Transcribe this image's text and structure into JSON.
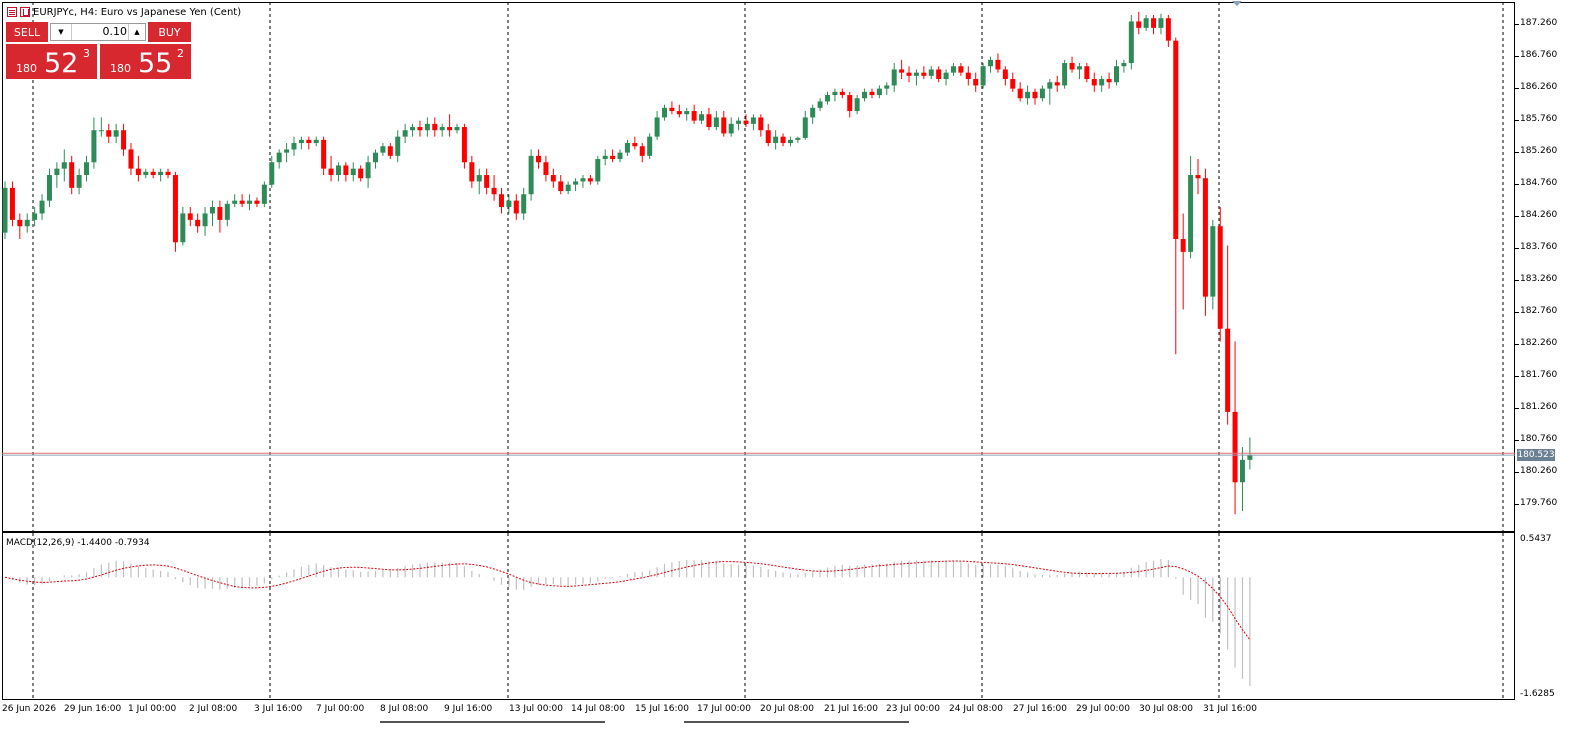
{
  "window": {
    "title": "EURJPYc, H4:  Euro vs Japanese Yen (Cent)",
    "icons": [
      "chart-list-icon",
      "one-click-trading-icon"
    ]
  },
  "trade_panel": {
    "sell_label": "SELL",
    "buy_label": "BUY",
    "lot_value": "0.10",
    "lot_down_icon": "triangle-down-icon",
    "lot_up_icon": "triangle-up-icon",
    "sell_price": {
      "int": "180",
      "big": "52",
      "sup": "3"
    },
    "buy_price": {
      "int": "180",
      "big": "55",
      "sup": "2"
    },
    "color": "#d8282f"
  },
  "price_axis": {
    "labels": [
      "187.260",
      "186.760",
      "186.260",
      "185.760",
      "185.260",
      "184.760",
      "184.260",
      "183.760",
      "183.260",
      "182.760",
      "182.260",
      "181.760",
      "181.260",
      "180.760",
      "180.260",
      "179.760"
    ],
    "current_price": "180.523",
    "current_price_color": "#6c8094"
  },
  "macd": {
    "label": "MACD(12,26,9) -1.4400 -0.7934",
    "axis_max": "0.5437",
    "axis_min": "-1.6285",
    "signal_color": "#e0000a",
    "histogram_color": "#c0c0c0"
  },
  "time_axis": {
    "labels": [
      "26 Jun 2026",
      "29 Jun 16:00",
      "1 Jul 00:00",
      "2 Jul 08:00",
      "3 Jul 16:00",
      "7 Jul 00:00",
      "8 Jul 08:00",
      "9 Jul 16:00",
      "13 Jul 00:00",
      "14 Jul 08:00",
      "15 Jul 16:00",
      "17 Jul 00:00",
      "20 Jul 08:00",
      "21 Jul 16:00",
      "23 Jul 00:00",
      "24 Jul 08:00",
      "27 Jul 16:00",
      "29 Jul 00:00",
      "30 Jul 08:00",
      "31 Jul 16:00"
    ]
  },
  "chart_data": {
    "type": "candlestick",
    "symbol": "EURJPYc",
    "timeframe": "H4",
    "bull_color": "#2e8b57",
    "bear_color": "#ff0000",
    "ylim": [
      179.55,
      187.55
    ],
    "candles": [
      {
        "o": 184.0,
        "h": 184.8,
        "l": 183.9,
        "c": 184.7
      },
      {
        "o": 184.7,
        "h": 184.8,
        "l": 184.1,
        "c": 184.2
      },
      {
        "o": 184.2,
        "h": 184.3,
        "l": 183.9,
        "c": 184.1
      },
      {
        "o": 184.1,
        "h": 184.3,
        "l": 184.0,
        "c": 184.2
      },
      {
        "o": 184.2,
        "h": 184.4,
        "l": 184.1,
        "c": 184.3
      },
      {
        "o": 184.3,
        "h": 184.6,
        "l": 184.2,
        "c": 184.5
      },
      {
        "o": 184.5,
        "h": 185.0,
        "l": 184.4,
        "c": 184.9
      },
      {
        "o": 184.9,
        "h": 185.1,
        "l": 184.7,
        "c": 185.0
      },
      {
        "o": 185.0,
        "h": 185.3,
        "l": 184.8,
        "c": 185.1
      },
      {
        "o": 185.1,
        "h": 185.2,
        "l": 184.6,
        "c": 184.7
      },
      {
        "o": 184.7,
        "h": 185.0,
        "l": 184.6,
        "c": 184.9
      },
      {
        "o": 184.9,
        "h": 185.2,
        "l": 184.8,
        "c": 185.1
      },
      {
        "o": 185.1,
        "h": 185.8,
        "l": 185.0,
        "c": 185.6
      },
      {
        "o": 185.6,
        "h": 185.8,
        "l": 185.5,
        "c": 185.6
      },
      {
        "o": 185.6,
        "h": 185.7,
        "l": 185.4,
        "c": 185.5
      },
      {
        "o": 185.5,
        "h": 185.7,
        "l": 185.4,
        "c": 185.6
      },
      {
        "o": 185.6,
        "h": 185.7,
        "l": 185.2,
        "c": 185.3
      },
      {
        "o": 185.3,
        "h": 185.4,
        "l": 184.9,
        "c": 185.0
      },
      {
        "o": 185.0,
        "h": 185.2,
        "l": 184.8,
        "c": 184.9
      },
      {
        "o": 184.9,
        "h": 185.0,
        "l": 184.85,
        "c": 184.95
      },
      {
        "o": 184.95,
        "h": 185.0,
        "l": 184.85,
        "c": 184.9
      },
      {
        "o": 184.9,
        "h": 185.0,
        "l": 184.8,
        "c": 184.95
      },
      {
        "o": 184.95,
        "h": 185.0,
        "l": 184.85,
        "c": 184.9
      },
      {
        "o": 184.9,
        "h": 184.95,
        "l": 183.7,
        "c": 183.85
      },
      {
        "o": 183.85,
        "h": 184.4,
        "l": 183.8,
        "c": 184.3
      },
      {
        "o": 184.3,
        "h": 184.4,
        "l": 184.1,
        "c": 184.2
      },
      {
        "o": 184.2,
        "h": 184.3,
        "l": 184.0,
        "c": 184.1
      },
      {
        "o": 184.1,
        "h": 184.4,
        "l": 183.95,
        "c": 184.3
      },
      {
        "o": 184.3,
        "h": 184.5,
        "l": 184.1,
        "c": 184.4
      },
      {
        "o": 184.4,
        "h": 184.5,
        "l": 184.0,
        "c": 184.2
      },
      {
        "o": 184.2,
        "h": 184.5,
        "l": 184.1,
        "c": 184.45
      },
      {
        "o": 184.45,
        "h": 184.6,
        "l": 184.4,
        "c": 184.5
      },
      {
        "o": 184.5,
        "h": 184.6,
        "l": 184.4,
        "c": 184.45
      },
      {
        "o": 184.45,
        "h": 184.6,
        "l": 184.35,
        "c": 184.5
      },
      {
        "o": 184.5,
        "h": 184.55,
        "l": 184.4,
        "c": 184.45
      },
      {
        "o": 184.45,
        "h": 184.8,
        "l": 184.4,
        "c": 184.75
      },
      {
        "o": 184.75,
        "h": 185.2,
        "l": 184.7,
        "c": 185.1
      },
      {
        "o": 185.1,
        "h": 185.3,
        "l": 185.0,
        "c": 185.25
      },
      {
        "o": 185.25,
        "h": 185.4,
        "l": 185.1,
        "c": 185.3
      },
      {
        "o": 185.3,
        "h": 185.5,
        "l": 185.2,
        "c": 185.4
      },
      {
        "o": 185.4,
        "h": 185.5,
        "l": 185.3,
        "c": 185.45
      },
      {
        "o": 185.45,
        "h": 185.5,
        "l": 185.3,
        "c": 185.4
      },
      {
        "o": 185.4,
        "h": 185.5,
        "l": 185.35,
        "c": 185.45
      },
      {
        "o": 185.45,
        "h": 185.5,
        "l": 184.9,
        "c": 185.0
      },
      {
        "o": 185.0,
        "h": 185.2,
        "l": 184.8,
        "c": 184.9
      },
      {
        "o": 184.9,
        "h": 185.1,
        "l": 184.8,
        "c": 185.05
      },
      {
        "o": 185.05,
        "h": 185.1,
        "l": 184.8,
        "c": 184.9
      },
      {
        "o": 184.9,
        "h": 185.1,
        "l": 184.8,
        "c": 185.0
      },
      {
        "o": 185.0,
        "h": 185.05,
        "l": 184.8,
        "c": 184.85
      },
      {
        "o": 184.85,
        "h": 185.2,
        "l": 184.7,
        "c": 185.1
      },
      {
        "o": 185.1,
        "h": 185.3,
        "l": 185.0,
        "c": 185.25
      },
      {
        "o": 185.25,
        "h": 185.4,
        "l": 185.2,
        "c": 185.35
      },
      {
        "o": 185.35,
        "h": 185.4,
        "l": 185.15,
        "c": 185.2
      },
      {
        "o": 185.2,
        "h": 185.6,
        "l": 185.1,
        "c": 185.5
      },
      {
        "o": 185.5,
        "h": 185.7,
        "l": 185.4,
        "c": 185.6
      },
      {
        "o": 185.6,
        "h": 185.7,
        "l": 185.5,
        "c": 185.65
      },
      {
        "o": 185.65,
        "h": 185.75,
        "l": 185.5,
        "c": 185.6
      },
      {
        "o": 185.6,
        "h": 185.8,
        "l": 185.5,
        "c": 185.7
      },
      {
        "o": 185.7,
        "h": 185.8,
        "l": 185.5,
        "c": 185.6
      },
      {
        "o": 185.6,
        "h": 185.7,
        "l": 185.5,
        "c": 185.65
      },
      {
        "o": 185.65,
        "h": 185.85,
        "l": 185.5,
        "c": 185.6
      },
      {
        "o": 185.6,
        "h": 185.7,
        "l": 185.55,
        "c": 185.65
      },
      {
        "o": 185.65,
        "h": 185.7,
        "l": 185.0,
        "c": 185.1
      },
      {
        "o": 185.1,
        "h": 185.2,
        "l": 184.7,
        "c": 184.8
      },
      {
        "o": 184.8,
        "h": 185.0,
        "l": 184.6,
        "c": 184.9
      },
      {
        "o": 184.9,
        "h": 185.0,
        "l": 184.6,
        "c": 184.7
      },
      {
        "o": 184.7,
        "h": 184.9,
        "l": 184.5,
        "c": 184.6
      },
      {
        "o": 184.6,
        "h": 184.7,
        "l": 184.3,
        "c": 184.4
      },
      {
        "o": 184.4,
        "h": 184.6,
        "l": 184.3,
        "c": 184.5
      },
      {
        "o": 184.5,
        "h": 184.6,
        "l": 184.2,
        "c": 184.3
      },
      {
        "o": 184.3,
        "h": 184.7,
        "l": 184.2,
        "c": 184.6
      },
      {
        "o": 184.6,
        "h": 185.3,
        "l": 184.5,
        "c": 185.2
      },
      {
        "o": 185.2,
        "h": 185.3,
        "l": 185.0,
        "c": 185.1
      },
      {
        "o": 185.1,
        "h": 185.2,
        "l": 184.8,
        "c": 184.9
      },
      {
        "o": 184.9,
        "h": 185.0,
        "l": 184.7,
        "c": 184.8
      },
      {
        "o": 184.8,
        "h": 184.9,
        "l": 184.6,
        "c": 184.65
      },
      {
        "o": 184.65,
        "h": 184.8,
        "l": 184.6,
        "c": 184.75
      },
      {
        "o": 184.75,
        "h": 184.85,
        "l": 184.65,
        "c": 184.8
      },
      {
        "o": 184.8,
        "h": 184.9,
        "l": 184.7,
        "c": 184.85
      },
      {
        "o": 184.85,
        "h": 184.9,
        "l": 184.75,
        "c": 184.8
      },
      {
        "o": 184.8,
        "h": 185.2,
        "l": 184.75,
        "c": 185.15
      },
      {
        "o": 185.15,
        "h": 185.3,
        "l": 185.05,
        "c": 185.2
      },
      {
        "o": 185.2,
        "h": 185.3,
        "l": 185.1,
        "c": 185.15
      },
      {
        "o": 185.15,
        "h": 185.3,
        "l": 185.1,
        "c": 185.25
      },
      {
        "o": 185.25,
        "h": 185.45,
        "l": 185.2,
        "c": 185.4
      },
      {
        "o": 185.4,
        "h": 185.5,
        "l": 185.3,
        "c": 185.35
      },
      {
        "o": 185.35,
        "h": 185.4,
        "l": 185.1,
        "c": 185.2
      },
      {
        "o": 185.2,
        "h": 185.55,
        "l": 185.15,
        "c": 185.5
      },
      {
        "o": 185.5,
        "h": 185.9,
        "l": 185.45,
        "c": 185.8
      },
      {
        "o": 185.8,
        "h": 186.0,
        "l": 185.75,
        "c": 185.95
      },
      {
        "o": 185.95,
        "h": 186.05,
        "l": 185.85,
        "c": 185.9
      },
      {
        "o": 185.9,
        "h": 186.0,
        "l": 185.8,
        "c": 185.85
      },
      {
        "o": 185.85,
        "h": 185.95,
        "l": 185.75,
        "c": 185.9
      },
      {
        "o": 185.9,
        "h": 186.0,
        "l": 185.7,
        "c": 185.75
      },
      {
        "o": 185.75,
        "h": 185.9,
        "l": 185.7,
        "c": 185.85
      },
      {
        "o": 185.85,
        "h": 185.95,
        "l": 185.6,
        "c": 185.65
      },
      {
        "o": 185.65,
        "h": 185.9,
        "l": 185.6,
        "c": 185.8
      },
      {
        "o": 185.8,
        "h": 185.9,
        "l": 185.5,
        "c": 185.55
      },
      {
        "o": 185.55,
        "h": 185.8,
        "l": 185.5,
        "c": 185.7
      },
      {
        "o": 185.7,
        "h": 185.8,
        "l": 185.6,
        "c": 185.75
      },
      {
        "o": 185.75,
        "h": 185.85,
        "l": 185.65,
        "c": 185.7
      },
      {
        "o": 185.7,
        "h": 185.85,
        "l": 185.6,
        "c": 185.8
      },
      {
        "o": 185.8,
        "h": 185.85,
        "l": 185.5,
        "c": 185.6
      },
      {
        "o": 185.6,
        "h": 185.7,
        "l": 185.35,
        "c": 185.4
      },
      {
        "o": 185.4,
        "h": 185.6,
        "l": 185.3,
        "c": 185.5
      },
      {
        "o": 185.5,
        "h": 185.55,
        "l": 185.35,
        "c": 185.4
      },
      {
        "o": 185.4,
        "h": 185.5,
        "l": 185.35,
        "c": 185.45
      },
      {
        "o": 185.45,
        "h": 185.5,
        "l": 185.4,
        "c": 185.48
      },
      {
        "o": 185.48,
        "h": 185.9,
        "l": 185.45,
        "c": 185.8
      },
      {
        "o": 185.8,
        "h": 186.0,
        "l": 185.7,
        "c": 185.95
      },
      {
        "o": 185.95,
        "h": 186.1,
        "l": 185.9,
        "c": 186.05
      },
      {
        "o": 186.05,
        "h": 186.2,
        "l": 186.0,
        "c": 186.15
      },
      {
        "o": 186.15,
        "h": 186.25,
        "l": 186.05,
        "c": 186.2
      },
      {
        "o": 186.2,
        "h": 186.25,
        "l": 186.1,
        "c": 186.15
      },
      {
        "o": 186.15,
        "h": 186.2,
        "l": 185.8,
        "c": 185.9
      },
      {
        "o": 185.9,
        "h": 186.15,
        "l": 185.85,
        "c": 186.1
      },
      {
        "o": 186.1,
        "h": 186.25,
        "l": 186.05,
        "c": 186.2
      },
      {
        "o": 186.2,
        "h": 186.25,
        "l": 186.1,
        "c": 186.15
      },
      {
        "o": 186.15,
        "h": 186.3,
        "l": 186.1,
        "c": 186.25
      },
      {
        "o": 186.25,
        "h": 186.35,
        "l": 186.15,
        "c": 186.3
      },
      {
        "o": 186.3,
        "h": 186.65,
        "l": 186.2,
        "c": 186.55
      },
      {
        "o": 186.55,
        "h": 186.7,
        "l": 186.4,
        "c": 186.5
      },
      {
        "o": 186.5,
        "h": 186.6,
        "l": 186.35,
        "c": 186.45
      },
      {
        "o": 186.45,
        "h": 186.55,
        "l": 186.3,
        "c": 186.5
      },
      {
        "o": 186.5,
        "h": 186.6,
        "l": 186.4,
        "c": 186.45
      },
      {
        "o": 186.45,
        "h": 186.6,
        "l": 186.4,
        "c": 186.55
      },
      {
        "o": 186.55,
        "h": 186.6,
        "l": 186.35,
        "c": 186.4
      },
      {
        "o": 186.4,
        "h": 186.55,
        "l": 186.3,
        "c": 186.5
      },
      {
        "o": 186.5,
        "h": 186.65,
        "l": 186.45,
        "c": 186.6
      },
      {
        "o": 186.6,
        "h": 186.65,
        "l": 186.45,
        "c": 186.5
      },
      {
        "o": 186.5,
        "h": 186.6,
        "l": 186.3,
        "c": 186.4
      },
      {
        "o": 186.4,
        "h": 186.5,
        "l": 186.2,
        "c": 186.3
      },
      {
        "o": 186.3,
        "h": 186.65,
        "l": 186.25,
        "c": 186.6
      },
      {
        "o": 186.6,
        "h": 186.75,
        "l": 186.5,
        "c": 186.7
      },
      {
        "o": 186.7,
        "h": 186.8,
        "l": 186.5,
        "c": 186.55
      },
      {
        "o": 186.55,
        "h": 186.6,
        "l": 186.3,
        "c": 186.4
      },
      {
        "o": 186.4,
        "h": 186.5,
        "l": 186.2,
        "c": 186.25
      },
      {
        "o": 186.25,
        "h": 186.35,
        "l": 186.05,
        "c": 186.1
      },
      {
        "o": 186.1,
        "h": 186.3,
        "l": 186.0,
        "c": 186.2
      },
      {
        "o": 186.2,
        "h": 186.25,
        "l": 186.0,
        "c": 186.1
      },
      {
        "o": 186.1,
        "h": 186.3,
        "l": 186.05,
        "c": 186.25
      },
      {
        "o": 186.25,
        "h": 186.4,
        "l": 186.0,
        "c": 186.35
      },
      {
        "o": 186.35,
        "h": 186.45,
        "l": 186.2,
        "c": 186.3
      },
      {
        "o": 186.3,
        "h": 186.7,
        "l": 186.25,
        "c": 186.65
      },
      {
        "o": 186.65,
        "h": 186.75,
        "l": 186.5,
        "c": 186.55
      },
      {
        "o": 186.55,
        "h": 186.65,
        "l": 186.4,
        "c": 186.6
      },
      {
        "o": 186.6,
        "h": 186.65,
        "l": 186.35,
        "c": 186.4
      },
      {
        "o": 186.4,
        "h": 186.5,
        "l": 186.2,
        "c": 186.3
      },
      {
        "o": 186.3,
        "h": 186.45,
        "l": 186.2,
        "c": 186.4
      },
      {
        "o": 186.4,
        "h": 186.5,
        "l": 186.25,
        "c": 186.35
      },
      {
        "o": 186.35,
        "h": 186.7,
        "l": 186.3,
        "c": 186.6
      },
      {
        "o": 186.6,
        "h": 186.7,
        "l": 186.5,
        "c": 186.65
      },
      {
        "o": 186.65,
        "h": 187.4,
        "l": 186.55,
        "c": 187.3
      },
      {
        "o": 187.3,
        "h": 187.45,
        "l": 187.1,
        "c": 187.2
      },
      {
        "o": 187.2,
        "h": 187.4,
        "l": 187.15,
        "c": 187.35
      },
      {
        "o": 187.35,
        "h": 187.4,
        "l": 187.1,
        "c": 187.2
      },
      {
        "o": 187.2,
        "h": 187.42,
        "l": 187.1,
        "c": 187.35
      },
      {
        "o": 187.35,
        "h": 187.4,
        "l": 186.9,
        "c": 187.0
      },
      {
        "o": 187.0,
        "h": 187.05,
        "l": 182.1,
        "c": 183.9
      },
      {
        "o": 183.9,
        "h": 184.3,
        "l": 182.8,
        "c": 183.7
      },
      {
        "o": 183.7,
        "h": 185.2,
        "l": 183.6,
        "c": 184.9
      },
      {
        "o": 184.9,
        "h": 185.15,
        "l": 184.6,
        "c": 184.85
      },
      {
        "o": 184.85,
        "h": 185.0,
        "l": 182.7,
        "c": 183.0
      },
      {
        "o": 183.0,
        "h": 184.2,
        "l": 182.8,
        "c": 184.1
      },
      {
        "o": 184.1,
        "h": 184.4,
        "l": 182.3,
        "c": 182.5
      },
      {
        "o": 182.5,
        "h": 183.8,
        "l": 181.0,
        "c": 181.2
      },
      {
        "o": 181.2,
        "h": 182.3,
        "l": 179.6,
        "c": 180.1
      },
      {
        "o": 180.1,
        "h": 180.65,
        "l": 179.65,
        "c": 180.45
      },
      {
        "o": 180.45,
        "h": 180.8,
        "l": 180.3,
        "c": 180.52
      }
    ]
  }
}
